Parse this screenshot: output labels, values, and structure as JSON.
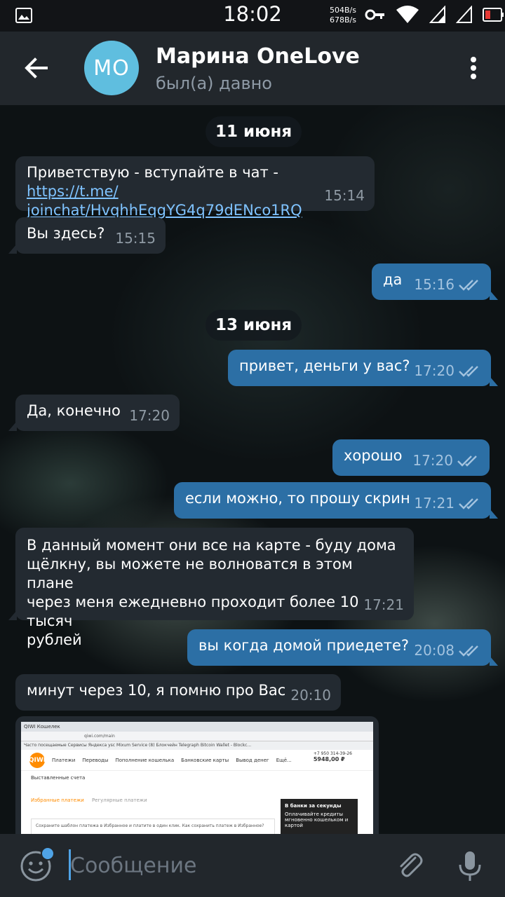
{
  "status_bar": {
    "time": "18:02",
    "speed_up": "504B/s",
    "speed_down": "678B/s"
  },
  "header": {
    "avatar_initials": "МО",
    "title": "Марина OneLove",
    "status": "был(а) давно"
  },
  "dates": [
    "11 июня",
    "13 июня"
  ],
  "messages": [
    {
      "dir": "in",
      "text_before_link": "Приветствую - вступайте в чат - ",
      "link_line1": "https://t.me/",
      "link_line2": "joinchat/HvqhhEqgYG4q79dENco1RQ",
      "time": "15:14"
    },
    {
      "dir": "in",
      "text": "Вы здесь?",
      "time": "15:15"
    },
    {
      "dir": "out",
      "text": "да",
      "time": "15:16"
    },
    {
      "dir": "out",
      "text": "привет, деньги у вас?",
      "time": "17:20"
    },
    {
      "dir": "in",
      "text": "Да, конечно",
      "time": "17:20"
    },
    {
      "dir": "out",
      "text": "хорошо",
      "time": "17:20"
    },
    {
      "dir": "out",
      "text": "если можно, то прошу скрин",
      "time": "17:21"
    },
    {
      "dir": "in",
      "lines": [
        "В данный момент они все на карте - буду дома",
        "щёлкну, вы можете не волноватся в этом плане",
        "через меня ежедневно проходит более 10 тысяч",
        "рублей"
      ],
      "time": "17:21"
    },
    {
      "dir": "out",
      "text": "вы когда домой приедете?",
      "time": "20:08"
    },
    {
      "dir": "in",
      "text": "минут через 10, я помню про Вас",
      "time": "20:10"
    }
  ],
  "photo": {
    "tab_title": "QIWI Кошелек",
    "url": "qiwi.com/main",
    "bookmarks": "Часто посещаемые   Сервисы Яндекса   ysc   Mixum Service   (8) Блокчейн   Telegraph   Bitcoin Wallet - Blockc...",
    "logo": "QIWI",
    "nav": [
      "Платежи",
      "Переводы",
      "Пополнение кошелька",
      "Банковские карты",
      "Вывод денег",
      "Ещё..."
    ],
    "phone": "+7 950 314-39-26",
    "balance": "5948,00 ₽",
    "invoices": "Выставленные счета",
    "tab_favorites": "Избранные платежи",
    "tab_regular": "Регулярные платежи",
    "card_title": "В банки за секунды",
    "card_text": "Оплачивайте кредиты мгновенно кошельком и картой",
    "hint": "Сохраните шаблон платежа в Избранное и платите в один клик. Как сохранить платеж в Избранное?"
  },
  "input": {
    "placeholder": "Сообщение"
  },
  "colors": {
    "header_bg": "#22272c",
    "incoming_bubble": "#232a31",
    "outgoing_bubble": "#2c6fa5",
    "avatar_bg": "#5fbedf",
    "accent": "#4fa3e6"
  }
}
